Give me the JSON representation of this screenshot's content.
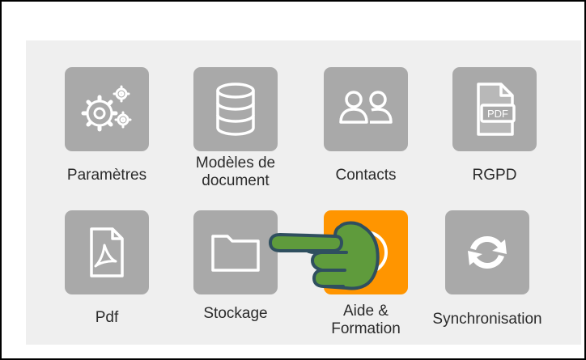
{
  "colors": {
    "tile_bg": "#a9a9a9",
    "tile_active_bg": "#ff9500",
    "panel_bg": "#efefef",
    "icon_stroke": "#ffffff",
    "hand_fill": "#5f9b3c",
    "hand_outline": "#2f4f5f"
  },
  "menu": {
    "items": [
      {
        "label": "Paramètres",
        "icon": "gears-icon",
        "active": false
      },
      {
        "label": "Modèles de\ndocument",
        "icon": "database-icon",
        "active": false
      },
      {
        "label": "Contacts",
        "icon": "contacts-icon",
        "active": false
      },
      {
        "label": "RGPD",
        "icon": "pdf-document-icon",
        "active": false
      },
      {
        "label": "Pdf",
        "icon": "acrobat-pdf-icon",
        "active": false
      },
      {
        "label": "Stockage",
        "icon": "folder-icon",
        "active": false
      },
      {
        "label": "Aide &\nFormation",
        "icon": "help-icon",
        "active": true
      },
      {
        "label": "Synchronisation",
        "icon": "sync-icon",
        "active": false
      }
    ],
    "rgpd_icon_text": "PDF"
  },
  "pointer": {
    "icon": "pointing-hand-icon"
  }
}
